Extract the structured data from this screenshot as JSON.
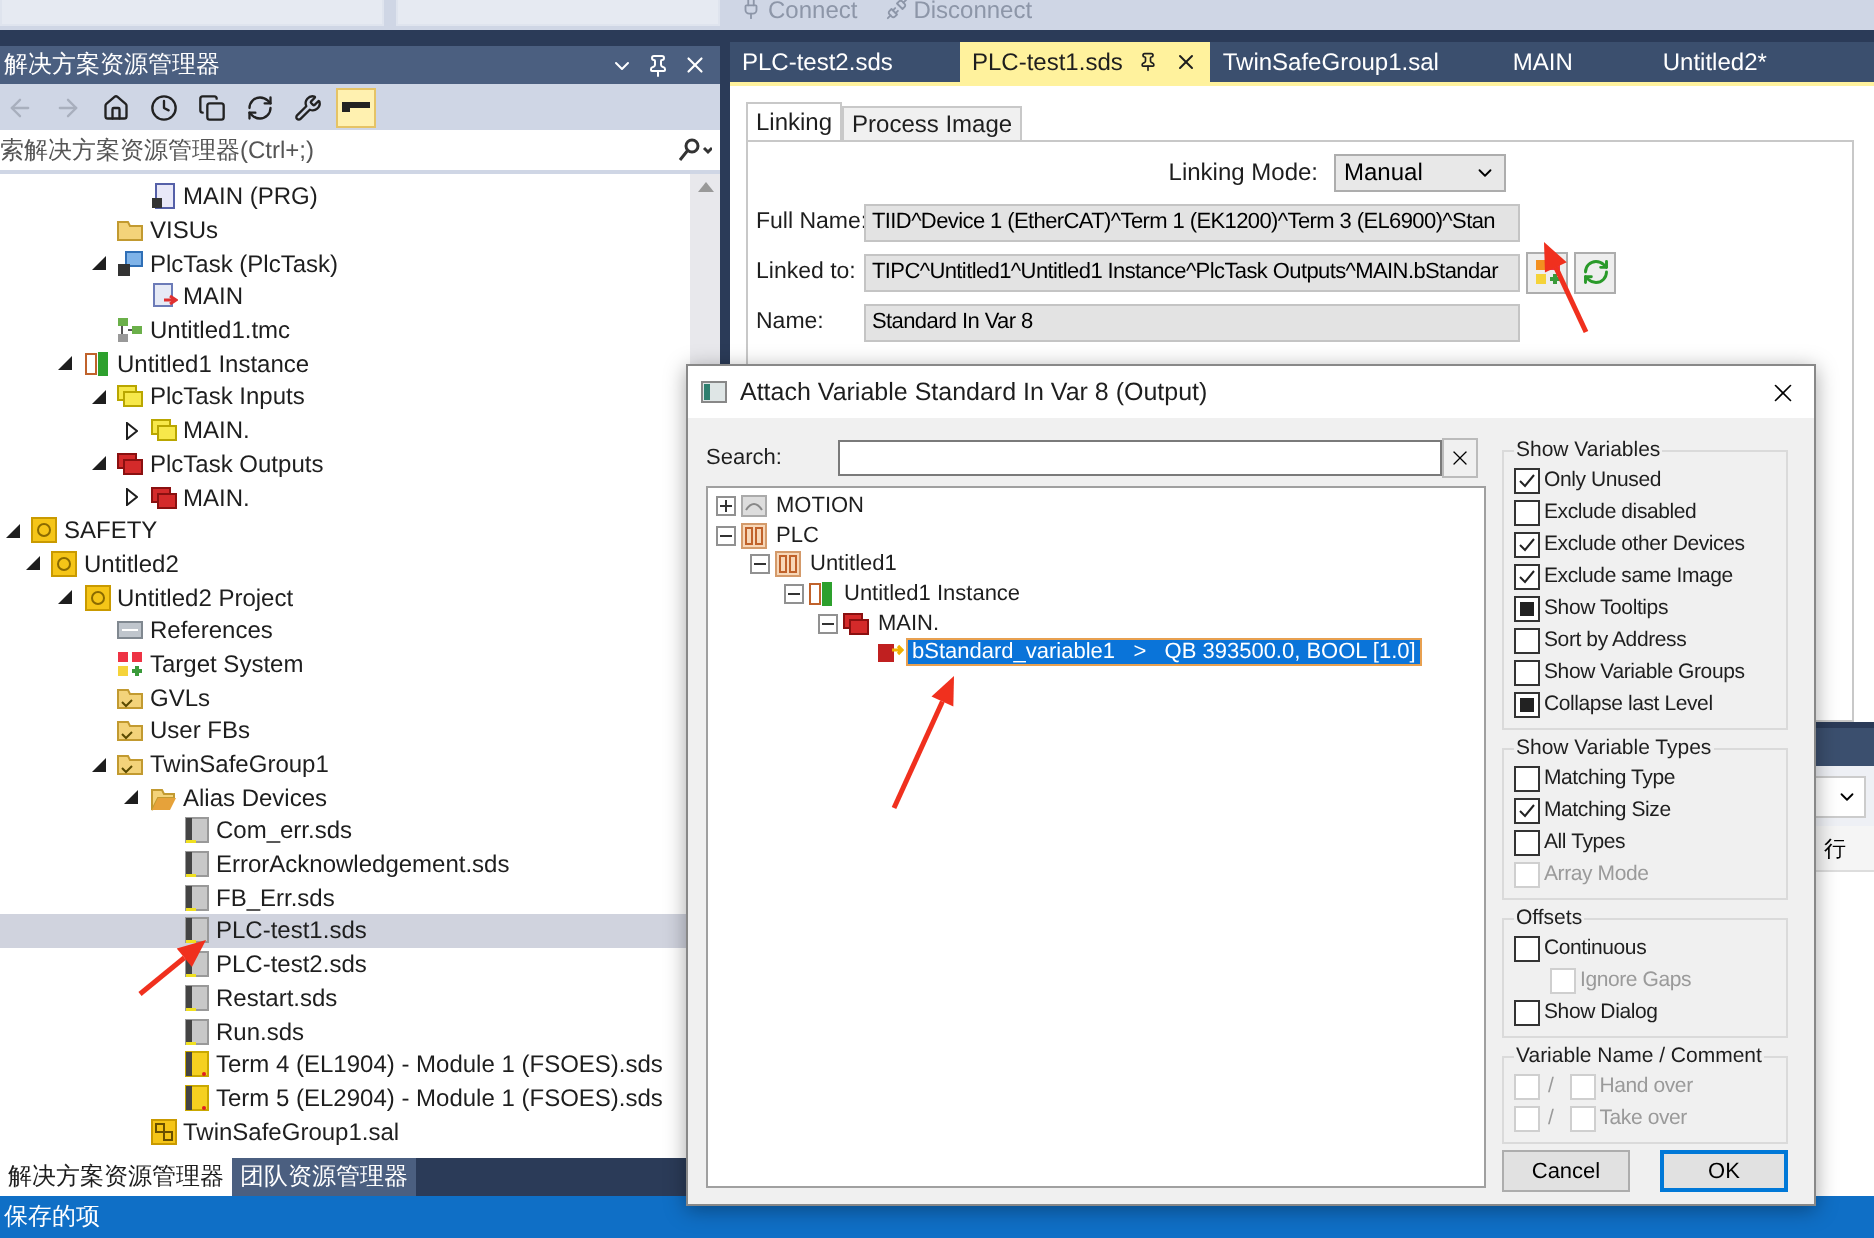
{
  "top_toolbar": {
    "buttons": [
      {
        "label": "Connect",
        "kind": "plug"
      },
      {
        "label": "Disconnect",
        "kind": "unplug"
      }
    ]
  },
  "solution_explorer": {
    "title": "解决方案资源管理器",
    "toolbar": [
      {
        "kind": "back",
        "disabled": true,
        "on": false
      },
      {
        "kind": "forward",
        "disabled": true,
        "on": false
      },
      {
        "kind": "home",
        "disabled": false,
        "on": false
      },
      {
        "kind": "history",
        "disabled": false,
        "on": false
      },
      {
        "kind": "windows",
        "disabled": false,
        "on": false
      },
      {
        "kind": "sync",
        "disabled": false,
        "on": false
      },
      {
        "kind": "properties",
        "disabled": false,
        "on": false
      },
      {
        "kind": "preview",
        "disabled": false,
        "on": true
      }
    ],
    "search": {
      "placeholder": "索解决方案资源管理器(Ctrl+;)"
    },
    "tree": [
      {
        "children": [
          {
            "children": [
              {
                "children": [
                  {
                    "children": [
                      {
                        "label": "MAIN (PRG)",
                        "kind": "program",
                        "selected": false
                      }
                    ]
                  },
                  {
                    "label": "VISUs",
                    "kind": "folder",
                    "selected": false
                  },
                  {
                    "label": "PlcTask (PlcTask)",
                    "kind": "task",
                    "selected": false,
                    "expanded": true,
                    "children": [
                      {
                        "label": "MAIN",
                        "kind": "task-ref",
                        "selected": false
                      }
                    ]
                  },
                  {
                    "label": "Untitled1.tmc",
                    "kind": "tmc",
                    "selected": false
                  }
                ]
              },
              {
                "label": "Untitled1 Instance",
                "kind": "instance",
                "selected": false,
                "expanded": true,
                "children": [
                  {
                    "label": "PlcTask Inputs",
                    "kind": "inputs",
                    "selected": false,
                    "expanded": true,
                    "children": [
                      {
                        "label": "MAIN.",
                        "kind": "inputs",
                        "selected": false,
                        "expanded": false
                      }
                    ]
                  },
                  {
                    "label": "PlcTask Outputs",
                    "kind": "outputs",
                    "selected": false,
                    "expanded": true,
                    "children": [
                      {
                        "label": "MAIN.",
                        "kind": "outputs",
                        "selected": false,
                        "expanded": false
                      }
                    ]
                  }
                ]
              }
            ]
          }
        ]
      },
      {
        "label": "SAFETY",
        "kind": "safety",
        "selected": false,
        "expanded": true,
        "children": [
          {
            "label": "Untitled2",
            "kind": "safety",
            "selected": false,
            "expanded": true,
            "children": [
              {
                "label": "Untitled2 Project",
                "kind": "safety-project",
                "selected": false,
                "expanded": true,
                "children": [
                  {
                    "label": "References",
                    "kind": "references",
                    "selected": false
                  },
                  {
                    "label": "Target System",
                    "kind": "target",
                    "selected": false
                  },
                  {
                    "label": "GVLs",
                    "kind": "safe-folder",
                    "selected": false
                  },
                  {
                    "label": "User FBs",
                    "kind": "safe-folder",
                    "selected": false
                  },
                  {
                    "label": "TwinSafeGroup1",
                    "kind": "safe-folder",
                    "selected": false,
                    "expanded": true,
                    "children": [
                      {
                        "label": "Alias Devices",
                        "kind": "open-folder",
                        "selected": false,
                        "expanded": true,
                        "children": [
                          {
                            "label": "Com_err.sds",
                            "kind": "sds",
                            "selected": false
                          },
                          {
                            "label": "ErrorAcknowledgement.sds",
                            "kind": "sds",
                            "selected": false
                          },
                          {
                            "label": "FB_Err.sds",
                            "kind": "sds",
                            "selected": false
                          },
                          {
                            "label": "PLC-test1.sds",
                            "kind": "sds",
                            "selected": true
                          },
                          {
                            "label": "PLC-test2.sds",
                            "kind": "sds",
                            "selected": false
                          },
                          {
                            "label": "Restart.sds",
                            "kind": "sds",
                            "selected": false
                          },
                          {
                            "label": "Run.sds",
                            "kind": "sds",
                            "selected": false
                          },
                          {
                            "label": "Term 4 (EL1904) - Module 1 (FSOES).sds",
                            "kind": "sds-terminal",
                            "selected": false
                          },
                          {
                            "label": "Term 5 (EL2904) - Module 1 (FSOES).sds",
                            "kind": "sds-terminal",
                            "selected": false
                          }
                        ]
                      },
                      {
                        "label": "TwinSafeGroup1.sal",
                        "kind": "sal",
                        "selected": false
                      }
                    ]
                  }
                ]
              }
            ]
          }
        ]
      }
    ],
    "bottom_tabs": [
      {
        "label": "解决方案资源管理器",
        "selected": true
      },
      {
        "label": "团队资源管理器",
        "selected": false
      }
    ]
  },
  "document_tabs": [
    {
      "label": "PLC-test2.sds",
      "selected": false
    },
    {
      "label": "PLC-test1.sds",
      "selected": true
    },
    {
      "label": "TwinSafeGroup1.sal",
      "selected": false
    },
    {
      "label": "MAIN",
      "selected": false
    },
    {
      "label": "Untitled2*",
      "selected": false
    }
  ],
  "linking_panel": {
    "tabs": [
      {
        "label": "Linking",
        "selected": true
      },
      {
        "label": "Process Image",
        "selected": false
      }
    ],
    "linking_mode": {
      "label": "Linking Mode:",
      "value": "Manual"
    },
    "fields": [
      {
        "label": "Full Name:",
        "value": "TIID^Device 1 (EtherCAT)^Term 1 (EK1200)^Term 3 (EL6900)^Stan",
        "kind": "text"
      },
      {
        "label": "Linked to:",
        "value": "TIPC^Untitled1^Untitled1 Instance^PlcTask Outputs^MAIN.bStandar",
        "kind": "link"
      },
      {
        "label": "Name:",
        "value": "Standard In Var 8",
        "kind": "text"
      }
    ]
  },
  "lower_panel": {
    "text": "行"
  },
  "dialog": {
    "title": "Attach Variable Standard In Var 8 (Output)",
    "search_label": "Search:",
    "tree": [
      {
        "label": "MOTION",
        "kind": "motion",
        "expanded": false,
        "selected": false
      },
      {
        "label": "PLC",
        "kind": "plc",
        "expanded": true,
        "selected": false,
        "children": [
          {
            "label": "Untitled1",
            "kind": "plc",
            "expanded": true,
            "selected": false,
            "children": [
              {
                "label": "Untitled1 Instance",
                "kind": "instance",
                "expanded": true,
                "selected": false,
                "children": [
                  {
                    "label": "MAIN.",
                    "kind": "outputs",
                    "expanded": true,
                    "selected": false,
                    "children": [
                      {
                        "label": "bStandard_variable1   >   QB 393500.0, BOOL [1.0]",
                        "kind": "variable",
                        "selected": true
                      }
                    ]
                  }
                ]
              }
            ]
          }
        ]
      }
    ],
    "groups": [
      {
        "title": "Show Variables",
        "items": [
          {
            "kind": "check",
            "label": "Only Unused",
            "checked": true,
            "disabled": false
          },
          {
            "kind": "check",
            "label": "Exclude disabled",
            "checked": false,
            "disabled": false
          },
          {
            "kind": "check",
            "label": "Exclude other Devices",
            "checked": true,
            "disabled": false
          },
          {
            "kind": "check",
            "label": "Exclude same Image",
            "checked": true,
            "disabled": false
          },
          {
            "kind": "square",
            "label": "Show Tooltips",
            "checked": true,
            "disabled": false
          },
          {
            "kind": "check",
            "label": "Sort by Address",
            "checked": false,
            "disabled": false
          },
          {
            "kind": "check",
            "label": "Show Variable Groups",
            "checked": false,
            "disabled": false
          },
          {
            "kind": "square",
            "label": "Collapse last Level",
            "checked": true,
            "disabled": false
          }
        ]
      },
      {
        "title": "Show Variable Types",
        "items": [
          {
            "kind": "check",
            "label": "Matching Type",
            "checked": false,
            "disabled": false
          },
          {
            "kind": "check",
            "label": "Matching Size",
            "checked": true,
            "disabled": false
          },
          {
            "kind": "check",
            "label": "All Types",
            "checked": false,
            "disabled": false
          },
          {
            "kind": "check",
            "label": "Array Mode",
            "checked": false,
            "disabled": true
          }
        ]
      },
      {
        "title": "Offsets",
        "items": [
          {
            "kind": "check",
            "label": "Continuous",
            "checked": false,
            "disabled": false,
            "children": [
              {
                "kind": "check",
                "label": "Ignore Gaps",
                "checked": false,
                "disabled": true
              }
            ]
          },
          {
            "kind": "check",
            "label": "Show Dialog",
            "checked": false,
            "disabled": false
          }
        ]
      },
      {
        "title": "Variable Name / Comment",
        "items": [
          {
            "kind": "pair",
            "separator": "/",
            "label": "Hand over",
            "first_checked": false,
            "checked": false,
            "disabled": true
          },
          {
            "kind": "pair",
            "separator": "/",
            "label": "Take over",
            "first_checked": false,
            "checked": false,
            "disabled": true
          }
        ]
      }
    ],
    "buttons": [
      {
        "label": "Cancel",
        "default": false
      },
      {
        "label": "OK",
        "default": true
      }
    ]
  },
  "status_bar": {
    "text": "保存的项"
  }
}
